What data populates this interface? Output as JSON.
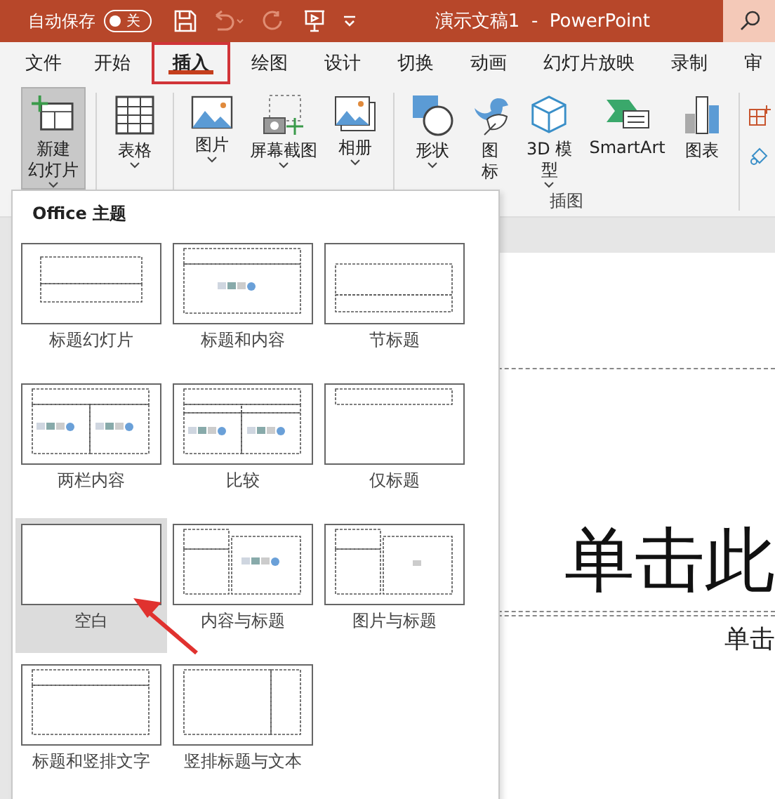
{
  "title_bar": {
    "autosave_label": "自动保存",
    "autosave": {
      "label": "关",
      "on": false
    },
    "title": "演示文稿1  -  PowerPoint"
  },
  "tabs": [
    {
      "label": "文件",
      "selected": false
    },
    {
      "label": "开始",
      "selected": false
    },
    {
      "label": "插入",
      "selected": true
    },
    {
      "label": "绘图",
      "selected": false
    },
    {
      "label": "设计",
      "selected": false
    },
    {
      "label": "切换",
      "selected": false
    },
    {
      "label": "动画",
      "selected": false
    },
    {
      "label": "幻灯片放映",
      "selected": false
    },
    {
      "label": "录制",
      "selected": false
    },
    {
      "label": "审",
      "selected": false
    }
  ],
  "ribbon": {
    "groups": [
      {
        "buttons": [
          {
            "lines": [
              "新建",
              "幻灯片"
            ],
            "pressed": true,
            "dropdown": true
          }
        ]
      },
      {
        "buttons": [
          {
            "lines": [
              "表格"
            ],
            "pressed": false,
            "dropdown": true
          }
        ]
      },
      {
        "buttons": [
          {
            "lines": [
              "图片"
            ],
            "pressed": false,
            "dropdown": true
          },
          {
            "lines": [
              "屏幕截图"
            ],
            "pressed": false,
            "dropdown": true
          },
          {
            "lines": [
              "相册"
            ],
            "pressed": false,
            "dropdown": true
          }
        ]
      },
      {
        "label": "插图",
        "buttons": [
          {
            "lines": [
              "形状"
            ],
            "pressed": false,
            "dropdown": true
          },
          {
            "lines": [
              "图",
              "标"
            ],
            "pressed": false,
            "dropdown": false
          },
          {
            "lines": [
              "3D 模",
              "型"
            ],
            "pressed": false,
            "dropdown": true
          },
          {
            "lines": [
              "SmartArt"
            ],
            "pressed": false,
            "dropdown": false
          },
          {
            "lines": [
              "图表"
            ],
            "pressed": false,
            "dropdown": false
          }
        ]
      }
    ]
  },
  "layout_menu": {
    "heading": "Office 主题",
    "layouts": [
      {
        "kind": "title",
        "label": "标题幻灯片",
        "selected": false
      },
      {
        "kind": "title-content",
        "label": "标题和内容",
        "selected": false
      },
      {
        "kind": "section",
        "label": "节标题",
        "selected": false
      },
      {
        "kind": "two-content",
        "label": "两栏内容",
        "selected": false
      },
      {
        "kind": "comparison",
        "label": "比较",
        "selected": false
      },
      {
        "kind": "title-only",
        "label": "仅标题",
        "selected": false
      },
      {
        "kind": "blank",
        "label": "空白",
        "selected": true
      },
      {
        "kind": "content-caption",
        "label": "内容与标题",
        "selected": false
      },
      {
        "kind": "picture-caption",
        "label": "图片与标题",
        "selected": false
      },
      {
        "kind": "title-vertical-text",
        "label": "标题和竖排文字",
        "selected": false
      },
      {
        "kind": "vertical-title-text",
        "label": "竖排标题与文本",
        "selected": false
      }
    ]
  },
  "slide": {
    "title_placeholder": "单击此",
    "subtitle_placeholder": "单击"
  }
}
